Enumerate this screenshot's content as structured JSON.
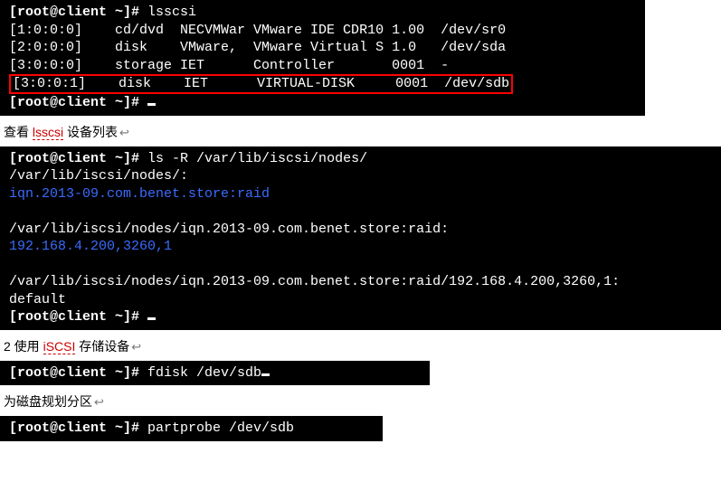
{
  "terminal1": {
    "prompt": "[root@client ~]# ",
    "cmd": "lsscsi",
    "rows": [
      "[1:0:0:0]    cd/dvd  NECVMWar VMware IDE CDR10 1.00  /dev/sr0",
      "[2:0:0:0]    disk    VMware,  VMware Virtual S 1.0   /dev/sda",
      "[3:0:0:0]    storage IET      Controller       0001  -"
    ],
    "highlight": "[3:0:0:1]    disk    IET      VIRTUAL-DISK     0001  /dev/sdb",
    "prompt2": "[root@client ~]# "
  },
  "caption1": {
    "prefix": "查看 ",
    "term": "lsscsi",
    "suffix": " 设备列表"
  },
  "terminal2": {
    "prompt": "[root@client ~]# ",
    "cmd": "ls -R /var/lib/iscsi/nodes/",
    "line1": "/var/lib/iscsi/nodes/:",
    "blue1": "iqn.2013-09.com.benet.store:raid",
    "line2": "/var/lib/iscsi/nodes/iqn.2013-09.com.benet.store:raid:",
    "blue2": "192.168.4.200,3260,1",
    "line3": "/var/lib/iscsi/nodes/iqn.2013-09.com.benet.store:raid/192.168.4.200,3260,1:",
    "line4": "default",
    "prompt2": "[root@client ~]# "
  },
  "caption2": {
    "prefix": "2 使用 ",
    "term": "iSCSI",
    "suffix": " 存储设备"
  },
  "terminal3": {
    "prompt": "[root@client ~]# ",
    "cmd": "fdisk /dev/sdb"
  },
  "caption3": {
    "text": "为磁盘规划分区"
  },
  "terminal4": {
    "prompt": "[root@client ~]# ",
    "cmd": "partprobe /dev/sdb"
  }
}
